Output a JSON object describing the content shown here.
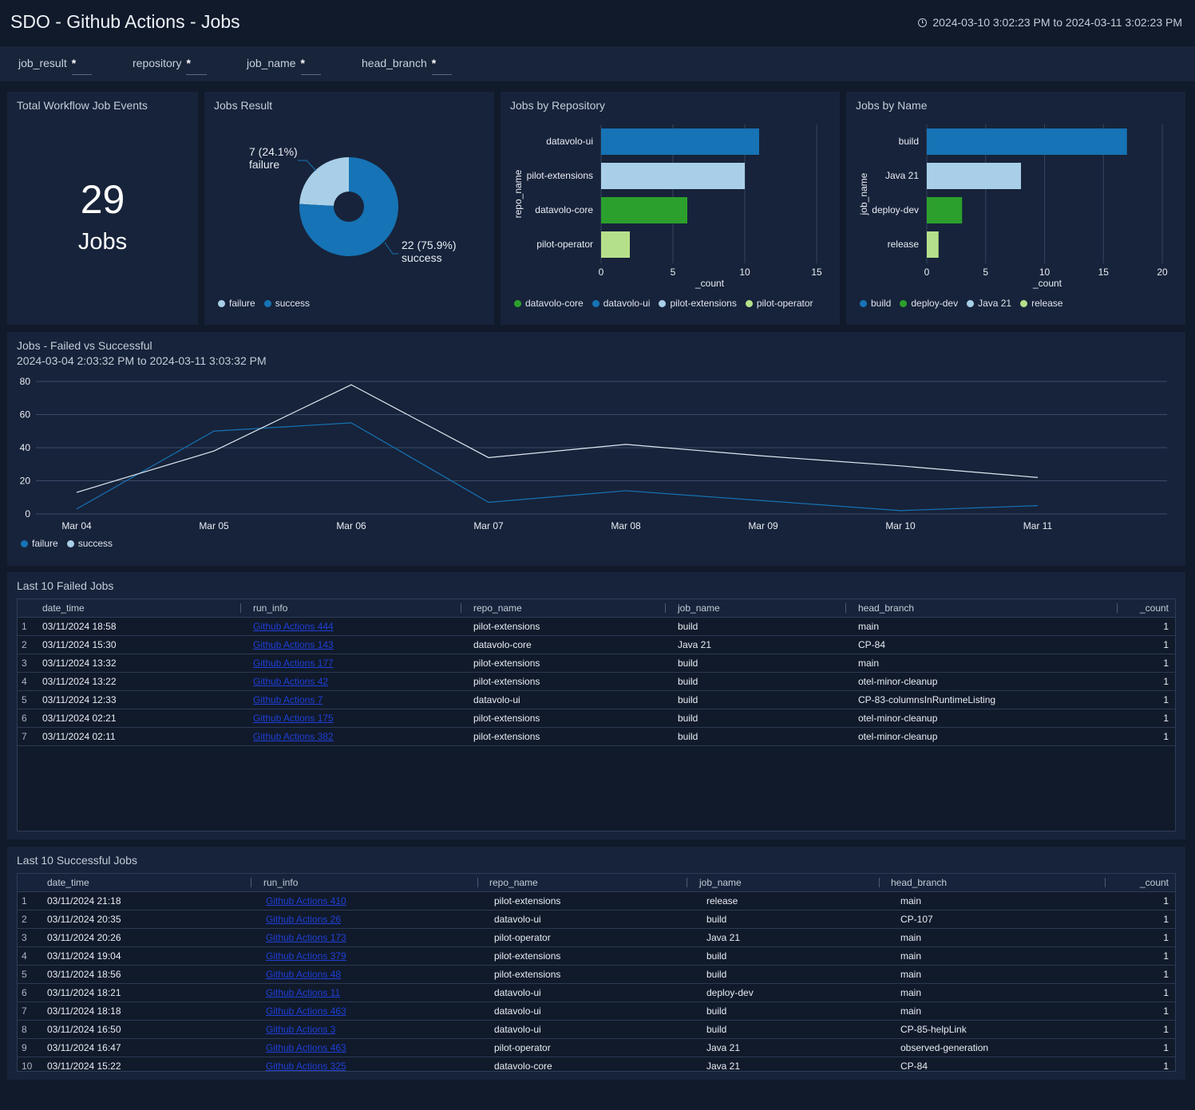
{
  "header": {
    "title": "SDO - Github Actions - Jobs",
    "time_range": "2024-03-10 3:02:23 PM to 2024-03-11 3:02:23 PM"
  },
  "filters": [
    {
      "name": "job_result",
      "value": "*"
    },
    {
      "name": "repository",
      "value": "*"
    },
    {
      "name": "job_name",
      "value": "*"
    },
    {
      "name": "head_branch",
      "value": "*"
    }
  ],
  "total_panel": {
    "title": "Total Workflow Job Events",
    "value": "29",
    "unit": "Jobs"
  },
  "colors": {
    "failure": "#a9cfe8",
    "success": "#1673b5",
    "datavolo_ui": "#1673b5",
    "pilot_extensions": "#a9cfe8",
    "datavolo_core": "#2ca02c",
    "pilot_operator": "#b5e08b"
  },
  "jobs_result": {
    "title": "Jobs Result",
    "failure_label": "7 (24.1%)",
    "failure_name": "failure",
    "success_label": "22 (75.9%)",
    "success_name": "success",
    "legend": [
      "failure",
      "success"
    ]
  },
  "jobs_by_repo": {
    "title": "Jobs by Repository",
    "ylabel": "repo_name",
    "xlabel": "_count",
    "legend": [
      "datavolo-core",
      "datavolo-ui",
      "pilot-extensions",
      "pilot-operator"
    ]
  },
  "jobs_by_name": {
    "title": "Jobs by Name",
    "ylabel": "job_name",
    "xlabel": "_count",
    "legend": [
      "build",
      "deploy-dev",
      "Java 21",
      "release"
    ]
  },
  "line_panel": {
    "title": "Jobs - Failed vs Successful",
    "subtitle": "2024-03-04 2:03:32 PM to 2024-03-11 3:03:32 PM",
    "legend": [
      "failure",
      "success"
    ]
  },
  "chart_data": [
    {
      "type": "pie",
      "title": "Jobs Result",
      "categories": [
        "failure",
        "success"
      ],
      "values": [
        7,
        22
      ],
      "colors": [
        "#a9cfe8",
        "#1673b5"
      ],
      "donut": true
    },
    {
      "type": "bar",
      "orientation": "horizontal",
      "title": "Jobs by Repository",
      "categories": [
        "datavolo-ui",
        "pilot-extensions",
        "datavolo-core",
        "pilot-operator"
      ],
      "values": [
        11,
        10,
        6,
        2
      ],
      "colors": [
        "#1673b5",
        "#a9cfe8",
        "#2ca02c",
        "#b5e08b"
      ],
      "xlabel": "_count",
      "ylabel": "repo_name",
      "xlim": [
        0,
        15
      ],
      "xticks": [
        0,
        5,
        10,
        15
      ]
    },
    {
      "type": "bar",
      "orientation": "horizontal",
      "title": "Jobs by Name",
      "categories": [
        "build",
        "Java 21",
        "deploy-dev",
        "release"
      ],
      "values": [
        17,
        8,
        3,
        1
      ],
      "colors": [
        "#1673b5",
        "#a9cfe8",
        "#2ca02c",
        "#b5e08b"
      ],
      "xlabel": "_count",
      "ylabel": "job_name",
      "xlim": [
        0,
        20
      ],
      "xticks": [
        0,
        5,
        10,
        15,
        20
      ]
    },
    {
      "type": "line",
      "title": "Jobs - Failed vs Successful",
      "x": [
        "Mar 04",
        "Mar 05",
        "Mar 06",
        "Mar 07",
        "Mar 08",
        "Mar 09",
        "Mar 10",
        "Mar 11"
      ],
      "ylim": [
        0,
        80
      ],
      "yticks": [
        0,
        20,
        40,
        60,
        80
      ],
      "series": [
        {
          "name": "failure",
          "color": "#1673b5",
          "values": [
            3,
            50,
            55,
            7,
            14,
            8,
            2,
            5
          ]
        },
        {
          "name": "success",
          "color": "#dfe8f2",
          "values": [
            13,
            38,
            78,
            34,
            42,
            35,
            29,
            22
          ]
        }
      ]
    }
  ],
  "failed_table": {
    "title": "Last 10 Failed Jobs",
    "columns": [
      "date_time",
      "run_info",
      "repo_name",
      "job_name",
      "head_branch",
      "_count"
    ],
    "rows": [
      {
        "idx": "1",
        "date_time": "03/11/2024 18:58",
        "run_info": "Github Actions 444",
        "repo_name": "pilot-extensions",
        "job_name": "build",
        "head_branch": "main",
        "count": "1"
      },
      {
        "idx": "2",
        "date_time": "03/11/2024 15:30",
        "run_info": "Github Actions 143",
        "repo_name": "datavolo-core",
        "job_name": "Java 21",
        "head_branch": "CP-84",
        "count": "1"
      },
      {
        "idx": "3",
        "date_time": "03/11/2024 13:32",
        "run_info": "Github Actions 177",
        "repo_name": "pilot-extensions",
        "job_name": "build",
        "head_branch": "main",
        "count": "1"
      },
      {
        "idx": "4",
        "date_time": "03/11/2024 13:22",
        "run_info": "Github Actions 42",
        "repo_name": "pilot-extensions",
        "job_name": "build",
        "head_branch": "otel-minor-cleanup",
        "count": "1"
      },
      {
        "idx": "5",
        "date_time": "03/11/2024 12:33",
        "run_info": "Github Actions 7",
        "repo_name": "datavolo-ui",
        "job_name": "build",
        "head_branch": "CP-83-columnsInRuntimeListing",
        "count": "1"
      },
      {
        "idx": "6",
        "date_time": "03/11/2024 02:21",
        "run_info": "Github Actions 175",
        "repo_name": "pilot-extensions",
        "job_name": "build",
        "head_branch": "otel-minor-cleanup",
        "count": "1"
      },
      {
        "idx": "7",
        "date_time": "03/11/2024 02:11",
        "run_info": "Github Actions 382",
        "repo_name": "pilot-extensions",
        "job_name": "build",
        "head_branch": "otel-minor-cleanup",
        "count": "1"
      }
    ]
  },
  "success_table": {
    "title": "Last 10 Successful Jobs",
    "columns": [
      "date_time",
      "run_info",
      "repo_name",
      "job_name",
      "head_branch",
      "_count"
    ],
    "rows": [
      {
        "idx": "1",
        "date_time": "03/11/2024 21:18",
        "run_info": "Github Actions 410",
        "repo_name": "pilot-extensions",
        "job_name": "release",
        "head_branch": "main",
        "count": "1"
      },
      {
        "idx": "2",
        "date_time": "03/11/2024 20:35",
        "run_info": "Github Actions 26",
        "repo_name": "datavolo-ui",
        "job_name": "build",
        "head_branch": "CP-107",
        "count": "1"
      },
      {
        "idx": "3",
        "date_time": "03/11/2024 20:26",
        "run_info": "Github Actions 173",
        "repo_name": "pilot-operator",
        "job_name": "Java 21",
        "head_branch": "main",
        "count": "1"
      },
      {
        "idx": "4",
        "date_time": "03/11/2024 19:04",
        "run_info": "Github Actions 379",
        "repo_name": "pilot-extensions",
        "job_name": "build",
        "head_branch": "main",
        "count": "1"
      },
      {
        "idx": "5",
        "date_time": "03/11/2024 18:56",
        "run_info": "Github Actions 48",
        "repo_name": "pilot-extensions",
        "job_name": "build",
        "head_branch": "main",
        "count": "1"
      },
      {
        "idx": "6",
        "date_time": "03/11/2024 18:21",
        "run_info": "Github Actions 11",
        "repo_name": "datavolo-ui",
        "job_name": "deploy-dev",
        "head_branch": "main",
        "count": "1"
      },
      {
        "idx": "7",
        "date_time": "03/11/2024 18:18",
        "run_info": "Github Actions 463",
        "repo_name": "datavolo-ui",
        "job_name": "build",
        "head_branch": "main",
        "count": "1"
      },
      {
        "idx": "8",
        "date_time": "03/11/2024 16:50",
        "run_info": "Github Actions 3",
        "repo_name": "datavolo-ui",
        "job_name": "build",
        "head_branch": "CP-85-helpLink",
        "count": "1"
      },
      {
        "idx": "9",
        "date_time": "03/11/2024 16:47",
        "run_info": "Github Actions 463",
        "repo_name": "pilot-operator",
        "job_name": "Java 21",
        "head_branch": "observed-generation",
        "count": "1"
      },
      {
        "idx": "10",
        "date_time": "03/11/2024 15:22",
        "run_info": "Github Actions 325",
        "repo_name": "datavolo-core",
        "job_name": "Java 21",
        "head_branch": "CP-84",
        "count": "1"
      }
    ]
  }
}
